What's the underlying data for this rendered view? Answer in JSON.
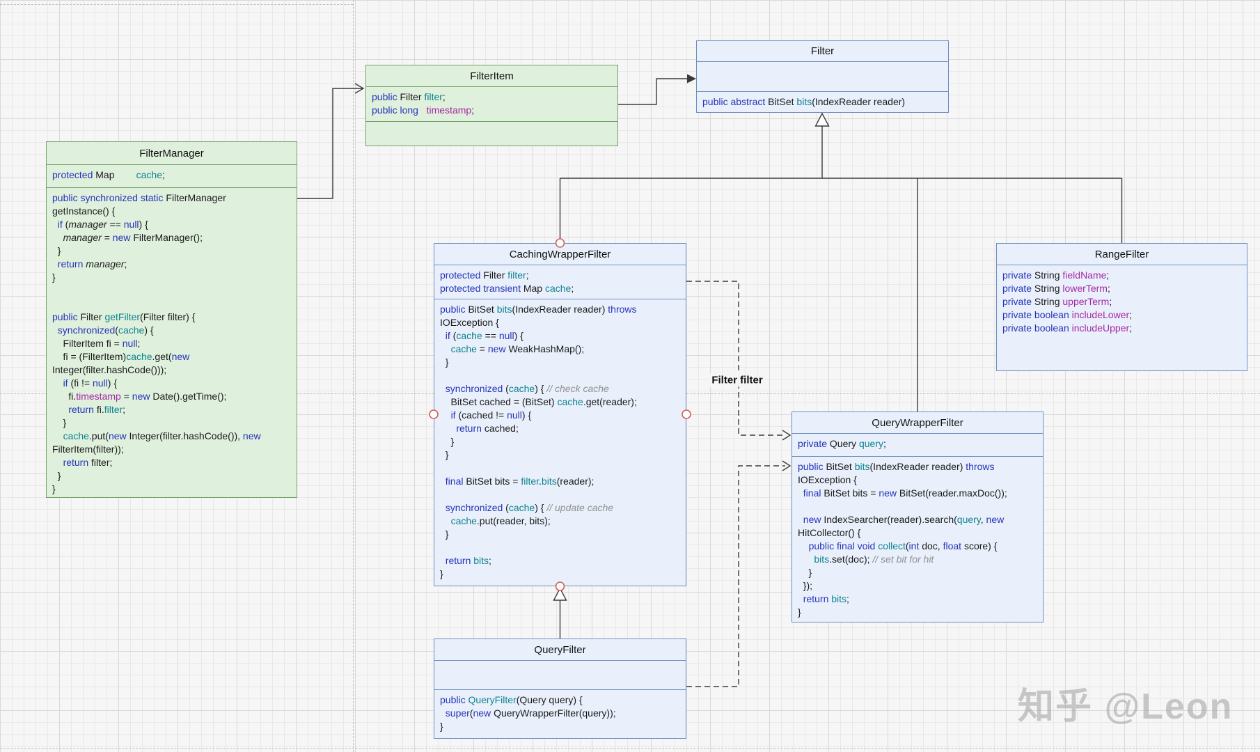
{
  "watermark": "知乎 @Leon",
  "edge_label": "Filter filter",
  "colors": {
    "box_green_fill": "#dff0dc",
    "box_green_stroke": "#74a066",
    "box_blue_fill": "#e9f0fb",
    "box_blue_stroke": "#6c8ebf",
    "syntax_keyword": "#2533b8",
    "syntax_type_teal": "#0f8290",
    "syntax_field_purple": "#a626a4",
    "syntax_comment": "#909090",
    "connector_red": "#d0605a"
  },
  "classes": [
    {
      "id": "filter-manager",
      "title": "FilterManager",
      "attributes": [
        [
          [
            "k",
            "protected "
          ],
          [
            "p",
            "Map        "
          ],
          [
            "t",
            "cache"
          ],
          [
            "p",
            ";"
          ]
        ]
      ],
      "methods": [
        [
          [
            "k",
            "public synchronized static "
          ],
          [
            "p",
            "FilterManager"
          ]
        ],
        [
          [
            "p",
            "getInstance() {"
          ]
        ],
        [
          [
            "p",
            "  "
          ],
          [
            "k",
            "if "
          ],
          [
            "p",
            "("
          ],
          [
            "i",
            "manager"
          ],
          [
            "p",
            " == "
          ],
          [
            "k",
            "null"
          ],
          [
            "p",
            ") {"
          ]
        ],
        [
          [
            "p",
            "    "
          ],
          [
            "i",
            "manager"
          ],
          [
            "p",
            " = "
          ],
          [
            "k",
            "new "
          ],
          [
            "p",
            "FilterManager();"
          ]
        ],
        [
          [
            "p",
            "  }"
          ]
        ],
        [
          [
            "p",
            "  "
          ],
          [
            "k",
            "return "
          ],
          [
            "i",
            "manager"
          ],
          [
            "p",
            ";"
          ]
        ],
        [
          [
            "p",
            "}"
          ]
        ],
        [],
        [],
        [
          [
            "k",
            "public "
          ],
          [
            "p",
            "Filter "
          ],
          [
            "t",
            "getFilter"
          ],
          [
            "p",
            "(Filter filter) {"
          ]
        ],
        [
          [
            "p",
            "  "
          ],
          [
            "k",
            "synchronized"
          ],
          [
            "p",
            "("
          ],
          [
            "t",
            "cache"
          ],
          [
            "p",
            ") {"
          ]
        ],
        [
          [
            "p",
            "    FilterItem fi = "
          ],
          [
            "k",
            "null"
          ],
          [
            "p",
            ";"
          ]
        ],
        [
          [
            "p",
            "    fi = (FilterItem)"
          ],
          [
            "t",
            "cache"
          ],
          [
            "p",
            ".get("
          ],
          [
            "k",
            "new"
          ]
        ],
        [
          [
            "p",
            "Integer(filter.hashCode()));"
          ]
        ],
        [
          [
            "p",
            "    "
          ],
          [
            "k",
            "if "
          ],
          [
            "p",
            "(fi != "
          ],
          [
            "k",
            "null"
          ],
          [
            "p",
            ") {"
          ]
        ],
        [
          [
            "p",
            "      fi."
          ],
          [
            "f",
            "timestamp"
          ],
          [
            "p",
            " = "
          ],
          [
            "k",
            "new "
          ],
          [
            "p",
            "Date().getTime();"
          ]
        ],
        [
          [
            "p",
            "      "
          ],
          [
            "k",
            "return "
          ],
          [
            "p",
            "fi."
          ],
          [
            "t",
            "filter"
          ],
          [
            "p",
            ";"
          ]
        ],
        [
          [
            "p",
            "    }"
          ]
        ],
        [
          [
            "p",
            "    "
          ],
          [
            "t",
            "cache"
          ],
          [
            "p",
            ".put("
          ],
          [
            "k",
            "new "
          ],
          [
            "p",
            "Integer(filter.hashCode()), "
          ],
          [
            "k",
            "new"
          ]
        ],
        [
          [
            "p",
            "FilterItem(filter));"
          ]
        ],
        [
          [
            "p",
            "    "
          ],
          [
            "k",
            "return "
          ],
          [
            "p",
            "filter;"
          ]
        ],
        [
          [
            "p",
            "  }"
          ]
        ],
        [
          [
            "p",
            "}"
          ]
        ]
      ]
    },
    {
      "id": "filter-item",
      "title": "FilterItem",
      "attributes": [
        [
          [
            "k",
            "public "
          ],
          [
            "p",
            "Filter "
          ],
          [
            "t",
            "filter"
          ],
          [
            "p",
            ";"
          ]
        ],
        [
          [
            "k",
            "public long"
          ],
          [
            "p",
            "   "
          ],
          [
            "f",
            "timestamp"
          ],
          [
            "p",
            ";"
          ]
        ]
      ],
      "methods": []
    },
    {
      "id": "filter",
      "title": "Filter",
      "attributes": [],
      "methods": [
        [
          [
            "k",
            "public abstract "
          ],
          [
            "p",
            "BitSet "
          ],
          [
            "t",
            "bits"
          ],
          [
            "p",
            "(IndexReader reader)"
          ]
        ]
      ]
    },
    {
      "id": "caching-wrapper-filter",
      "title": "CachingWrapperFilter",
      "attributes": [
        [
          [
            "k",
            "protected "
          ],
          [
            "p",
            "Filter "
          ],
          [
            "t",
            "filter"
          ],
          [
            "p",
            ";"
          ]
        ],
        [
          [
            "k",
            "protected transient "
          ],
          [
            "p",
            "Map "
          ],
          [
            "t",
            "cache"
          ],
          [
            "p",
            ";"
          ]
        ]
      ],
      "methods": [
        [
          [
            "k",
            "public "
          ],
          [
            "p",
            "BitSet "
          ],
          [
            "t",
            "bits"
          ],
          [
            "p",
            "(IndexReader reader) "
          ],
          [
            "k",
            "throws"
          ]
        ],
        [
          [
            "p",
            "IOException {"
          ]
        ],
        [
          [
            "p",
            "  "
          ],
          [
            "k",
            "if "
          ],
          [
            "p",
            "("
          ],
          [
            "t",
            "cache"
          ],
          [
            "p",
            " == "
          ],
          [
            "k",
            "null"
          ],
          [
            "p",
            ") {"
          ]
        ],
        [
          [
            "p",
            "    "
          ],
          [
            "t",
            "cache"
          ],
          [
            "p",
            " = "
          ],
          [
            "k",
            "new "
          ],
          [
            "p",
            "WeakHashMap();"
          ]
        ],
        [
          [
            "p",
            "  }"
          ]
        ],
        [],
        [
          [
            "p",
            "  "
          ],
          [
            "k",
            "synchronized "
          ],
          [
            "p",
            "("
          ],
          [
            "t",
            "cache"
          ],
          [
            "p",
            ") { "
          ],
          [
            "c",
            "// check cache"
          ]
        ],
        [
          [
            "p",
            "    BitSet cached = (BitSet) "
          ],
          [
            "t",
            "cache"
          ],
          [
            "p",
            ".get(reader);"
          ]
        ],
        [
          [
            "p",
            "    "
          ],
          [
            "k",
            "if "
          ],
          [
            "p",
            "(cached != "
          ],
          [
            "k",
            "null"
          ],
          [
            "p",
            ") {"
          ]
        ],
        [
          [
            "p",
            "      "
          ],
          [
            "k",
            "return "
          ],
          [
            "p",
            "cached;"
          ]
        ],
        [
          [
            "p",
            "    }"
          ]
        ],
        [
          [
            "p",
            "  }"
          ]
        ],
        [],
        [
          [
            "p",
            "  "
          ],
          [
            "k",
            "final "
          ],
          [
            "p",
            "BitSet bits = "
          ],
          [
            "t",
            "filter"
          ],
          [
            "p",
            "."
          ],
          [
            "t",
            "bits"
          ],
          [
            "p",
            "(reader);"
          ]
        ],
        [],
        [
          [
            "p",
            "  "
          ],
          [
            "k",
            "synchronized "
          ],
          [
            "p",
            "("
          ],
          [
            "t",
            "cache"
          ],
          [
            "p",
            ") { "
          ],
          [
            "c",
            "// update cache"
          ]
        ],
        [
          [
            "p",
            "    "
          ],
          [
            "t",
            "cache"
          ],
          [
            "p",
            ".put(reader, bits);"
          ]
        ],
        [
          [
            "p",
            "  }"
          ]
        ],
        [],
        [
          [
            "p",
            "  "
          ],
          [
            "k",
            "return "
          ],
          [
            "t",
            "bits"
          ],
          [
            "p",
            ";"
          ]
        ],
        [
          [
            "p",
            "}"
          ]
        ]
      ]
    },
    {
      "id": "range-filter",
      "title": "RangeFilter",
      "attributes": [
        [
          [
            "k",
            "private "
          ],
          [
            "p",
            "String "
          ],
          [
            "f",
            "fieldName"
          ],
          [
            "p",
            ";"
          ]
        ],
        [
          [
            "k",
            "private "
          ],
          [
            "p",
            "String "
          ],
          [
            "f",
            "lowerTerm"
          ],
          [
            "p",
            ";"
          ]
        ],
        [
          [
            "k",
            "private "
          ],
          [
            "p",
            "String "
          ],
          [
            "f",
            "upperTerm"
          ],
          [
            "p",
            ";"
          ]
        ],
        [
          [
            "k",
            "private boolean "
          ],
          [
            "f",
            "includeLower"
          ],
          [
            "p",
            ";"
          ]
        ],
        [
          [
            "k",
            "private boolean "
          ],
          [
            "f",
            "includeUpper"
          ],
          [
            "p",
            ";"
          ]
        ]
      ],
      "methods": []
    },
    {
      "id": "query-wrapper-filter",
      "title": "QueryWrapperFilter",
      "attributes": [
        [
          [
            "k",
            "private "
          ],
          [
            "p",
            "Query "
          ],
          [
            "t",
            "query"
          ],
          [
            "p",
            ";"
          ]
        ]
      ],
      "methods": [
        [
          [
            "k",
            "public "
          ],
          [
            "p",
            "BitSet "
          ],
          [
            "t",
            "bits"
          ],
          [
            "p",
            "(IndexReader reader) "
          ],
          [
            "k",
            "throws"
          ]
        ],
        [
          [
            "p",
            "IOException {"
          ]
        ],
        [
          [
            "p",
            "  "
          ],
          [
            "k",
            "final "
          ],
          [
            "p",
            "BitSet bits = "
          ],
          [
            "k",
            "new "
          ],
          [
            "p",
            "BitSet(reader.maxDoc());"
          ]
        ],
        [],
        [
          [
            "p",
            "  "
          ],
          [
            "k",
            "new "
          ],
          [
            "p",
            "IndexSearcher(reader).search("
          ],
          [
            "t",
            "query"
          ],
          [
            "p",
            ", "
          ],
          [
            "k",
            "new"
          ]
        ],
        [
          [
            "p",
            "HitCollector() {"
          ]
        ],
        [
          [
            "p",
            "    "
          ],
          [
            "k",
            "public final void "
          ],
          [
            "t",
            "collect"
          ],
          [
            "p",
            "("
          ],
          [
            "k",
            "int"
          ],
          [
            "p",
            " doc, "
          ],
          [
            "k",
            "float"
          ],
          [
            "p",
            " score) {"
          ]
        ],
        [
          [
            "p",
            "      "
          ],
          [
            "t",
            "bits"
          ],
          [
            "p",
            ".set(doc); "
          ],
          [
            "c",
            "// set bit for hit"
          ]
        ],
        [
          [
            "p",
            "    }"
          ]
        ],
        [
          [
            "p",
            "  });"
          ]
        ],
        [
          [
            "p",
            "  "
          ],
          [
            "k",
            "return "
          ],
          [
            "t",
            "bits"
          ],
          [
            "p",
            ";"
          ]
        ],
        [
          [
            "p",
            "}"
          ]
        ]
      ]
    },
    {
      "id": "query-filter",
      "title": "QueryFilter",
      "attributes": [],
      "methods": [
        [
          [
            "k",
            "public "
          ],
          [
            "t",
            "QueryFilter"
          ],
          [
            "p",
            "(Query query) {"
          ]
        ],
        [
          [
            "p",
            "  "
          ],
          [
            "k",
            "super"
          ],
          [
            "p",
            "("
          ],
          [
            "k",
            "new "
          ],
          [
            "p",
            "QueryWrapperFilter(query));"
          ]
        ],
        [
          [
            "p",
            "}"
          ]
        ]
      ]
    }
  ]
}
